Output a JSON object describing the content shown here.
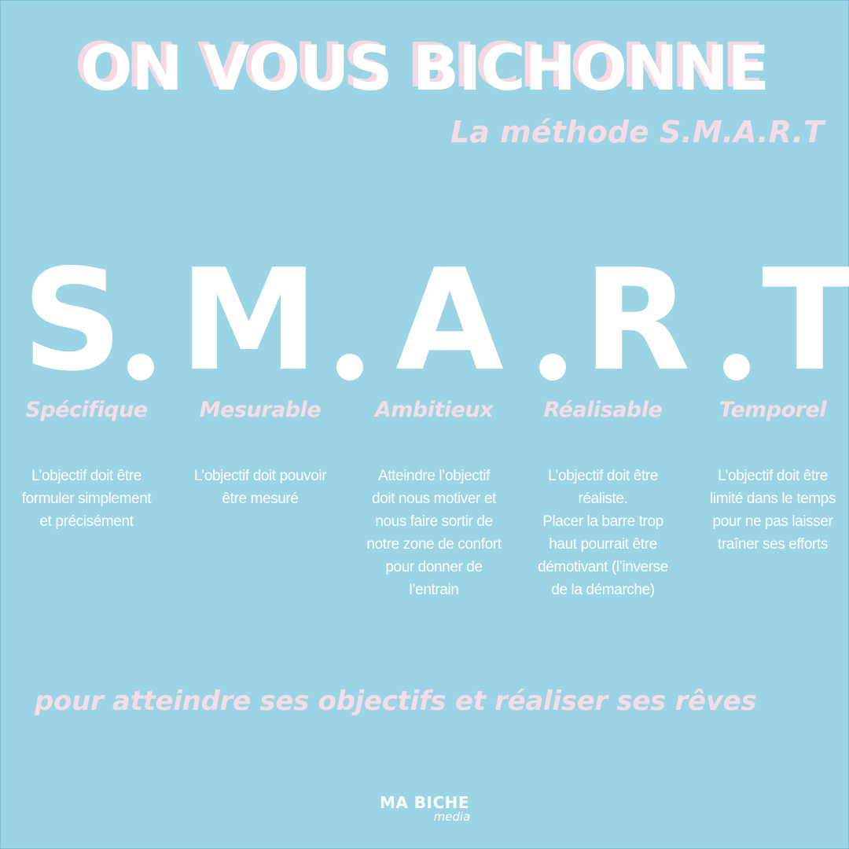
{
  "header": {
    "title": "ON VOUS BICHONNE",
    "subtitle": "La méthode S.M.A.R.T"
  },
  "acronym": {
    "letters": [
      "S",
      "M",
      "A",
      "R",
      "T"
    ]
  },
  "criteria": [
    {
      "word": "Spécifique",
      "description": "L’objectif doit être\nformuler simplement\net précisément"
    },
    {
      "word": "Mesurable",
      "description": "L’objectif doit pouvoir\nêtre mesuré"
    },
    {
      "word": "Ambitieux",
      "description": "Atteindre l’objectif\ndoit nous motiver et\nnous faire sortir de\nnotre zone de confort\npour donner de\nl’entrain"
    },
    {
      "word": "Réalisable",
      "description": "L’objectif doit être\nréaliste.\nPlacer la barre trop\nhaut pourrait être\ndémotivant (l’inverse\nde la démarche)"
    },
    {
      "word": "Temporel",
      "description": "L’objectif doit être\nlimité dans le temps\npour ne pas laisser\ntraîner ses efforts"
    }
  ],
  "footer": {
    "tagline": "pour atteindre ses objectifs et réaliser ses rêves",
    "logo_main": "MA BICHE",
    "logo_sub": "media"
  },
  "colors": {
    "background": "#9bd4e4",
    "accent_pink": "#f6dce6",
    "white": "#ffffff"
  }
}
